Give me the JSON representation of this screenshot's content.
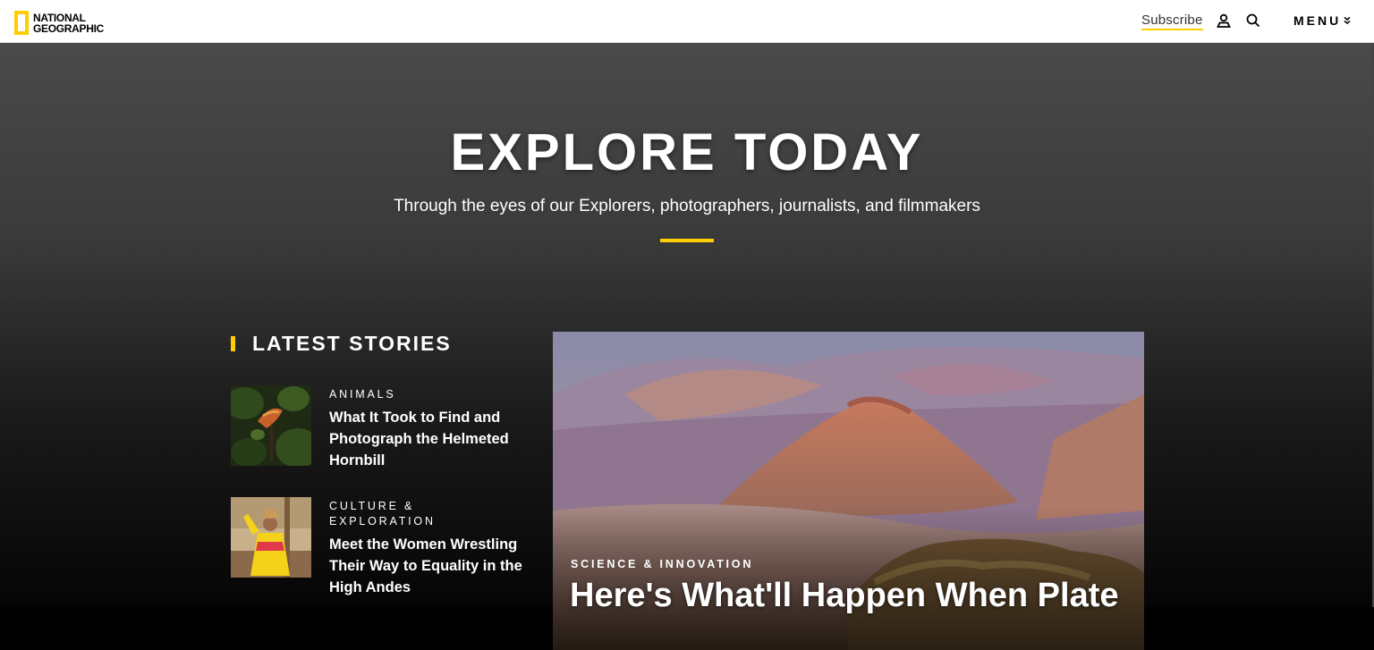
{
  "header": {
    "logo_line1": "NATIONAL",
    "logo_line2": "GEOGRAPHIC",
    "subscribe_label": "Subscribe",
    "menu_label": "MENU",
    "icons": [
      "user-icon",
      "search-icon",
      "chevron-down-icon"
    ],
    "accent_color": "#ffce00"
  },
  "hero": {
    "title": "EXPLORE TODAY",
    "subtitle": "Through the eyes of our Explorers, photographers, journalists, and filmmakers"
  },
  "latest": {
    "heading": "LATEST STORIES",
    "stories": [
      {
        "category": "ANIMALS",
        "headline": "What It Took to Find and Photograph the Helmeted Hornbill"
      },
      {
        "category": "CULTURE & EXPLORATION",
        "headline": "Meet the Women Wrestling Their Way to Equality in the High Andes"
      }
    ]
  },
  "feature": {
    "category": "SCIENCE & INNOVATION",
    "headline": "Here's What'll Happen When Plate"
  }
}
